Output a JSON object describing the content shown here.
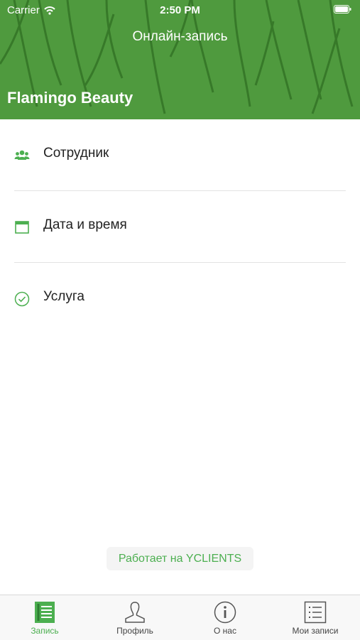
{
  "status_bar": {
    "carrier": "Carrier",
    "time": "2:50 PM"
  },
  "header": {
    "title": "Онлайн-запись",
    "salon": "Flamingo Beauty"
  },
  "menu": [
    {
      "label": "Сотрудник",
      "icon": "people-icon"
    },
    {
      "label": "Дата и время",
      "icon": "calendar-icon"
    },
    {
      "label": "Услуга",
      "icon": "check-circle-icon"
    }
  ],
  "powered_by": "Работает на YCLIENTS",
  "tabs": [
    {
      "label": "Запись",
      "icon": "booking-icon",
      "active": true
    },
    {
      "label": "Профиль",
      "icon": "profile-icon",
      "active": false
    },
    {
      "label": "О нас",
      "icon": "info-icon",
      "active": false
    },
    {
      "label": "Мои записи",
      "icon": "list-icon",
      "active": false
    }
  ],
  "colors": {
    "accent": "#4caf50",
    "header_bg": "#4f9a3e"
  }
}
